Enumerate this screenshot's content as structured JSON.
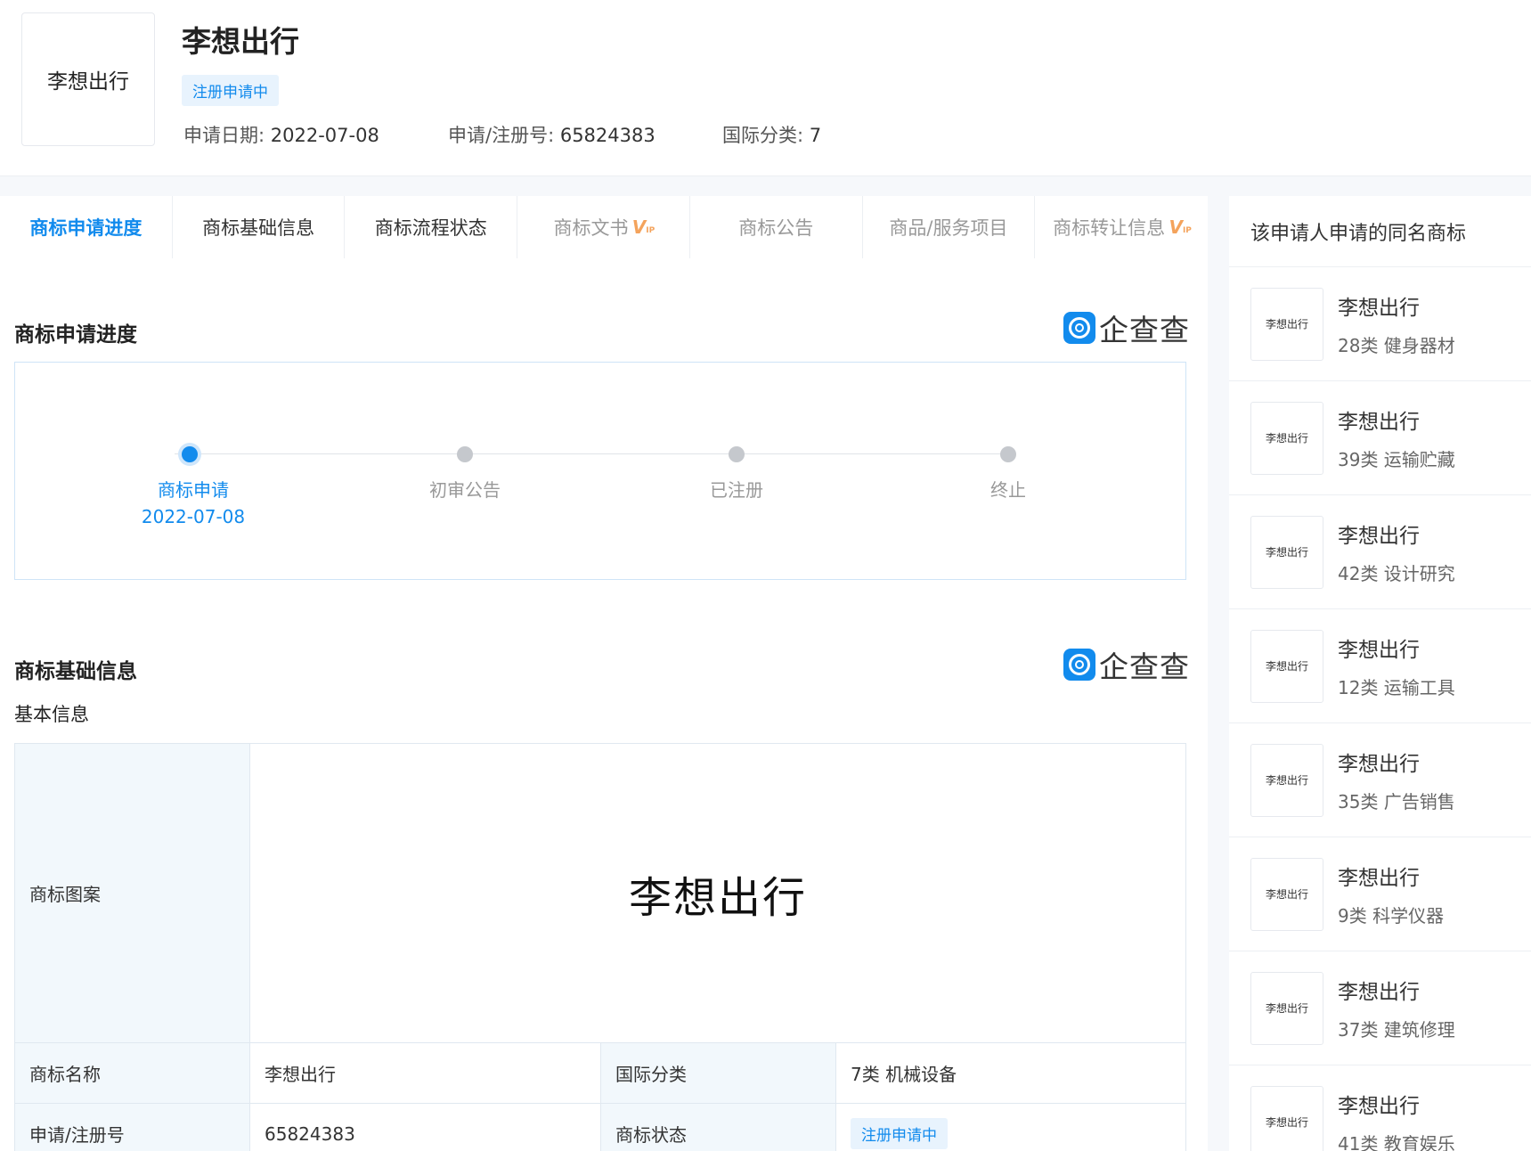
{
  "header": {
    "logo_text": "李想出行",
    "title": "李想出行",
    "status_badge": "注册申请中",
    "meta": [
      {
        "label": "申请日期: ",
        "value": "2022-07-08"
      },
      {
        "label": "申请/注册号: ",
        "value": "65824383"
      },
      {
        "label": "国际分类: ",
        "value": "7"
      }
    ]
  },
  "tabs": [
    {
      "label": "商标申请进度",
      "vip": false
    },
    {
      "label": "商标基础信息",
      "vip": false
    },
    {
      "label": "商标流程状态",
      "vip": false
    },
    {
      "label": "商标文书",
      "vip": true
    },
    {
      "label": "商标公告",
      "vip": false
    },
    {
      "label": "商品/服务项目",
      "vip": false
    },
    {
      "label": "商标转让信息",
      "vip": true
    }
  ],
  "vip_badge": {
    "letter": "V",
    "small": "IP"
  },
  "brand": {
    "name": "企查查"
  },
  "progress": {
    "title": "商标申请进度",
    "steps": [
      {
        "label": "商标申请",
        "date": "2022-07-08",
        "active": true
      },
      {
        "label": "初审公告",
        "date": "",
        "active": false
      },
      {
        "label": "已注册",
        "date": "",
        "active": false
      },
      {
        "label": "终止",
        "date": "",
        "active": false
      }
    ]
  },
  "basic_info": {
    "title": "商标基础信息",
    "subtitle": "基本信息",
    "pattern_label": "商标图案",
    "pattern_text": "李想出行",
    "rows": [
      {
        "k1": "商标名称",
        "v1": "李想出行",
        "k2": "国际分类",
        "v2": "7类 机械设备"
      },
      {
        "k1": "申请/注册号",
        "v1": "65824383",
        "k2": "商标状态",
        "v2": "注册申请中"
      }
    ]
  },
  "sidebar": {
    "title": "该申请人申请的同名商标",
    "items": [
      {
        "thumb": "李想出行",
        "name": "李想出行",
        "cls": "28类 健身器材"
      },
      {
        "thumb": "李想出行",
        "name": "李想出行",
        "cls": "39类 运输贮藏"
      },
      {
        "thumb": "李想出行",
        "name": "李想出行",
        "cls": "42类 设计研究"
      },
      {
        "thumb": "李想出行",
        "name": "李想出行",
        "cls": "12类 运输工具"
      },
      {
        "thumb": "李想出行",
        "name": "李想出行",
        "cls": "35类 广告销售"
      },
      {
        "thumb": "李想出行",
        "name": "李想出行",
        "cls": "9类 科学仪器"
      },
      {
        "thumb": "李想出行",
        "name": "李想出行",
        "cls": "37类 建筑修理"
      },
      {
        "thumb": "李想出行",
        "name": "李想出行",
        "cls": "41类 教育娱乐"
      }
    ]
  }
}
